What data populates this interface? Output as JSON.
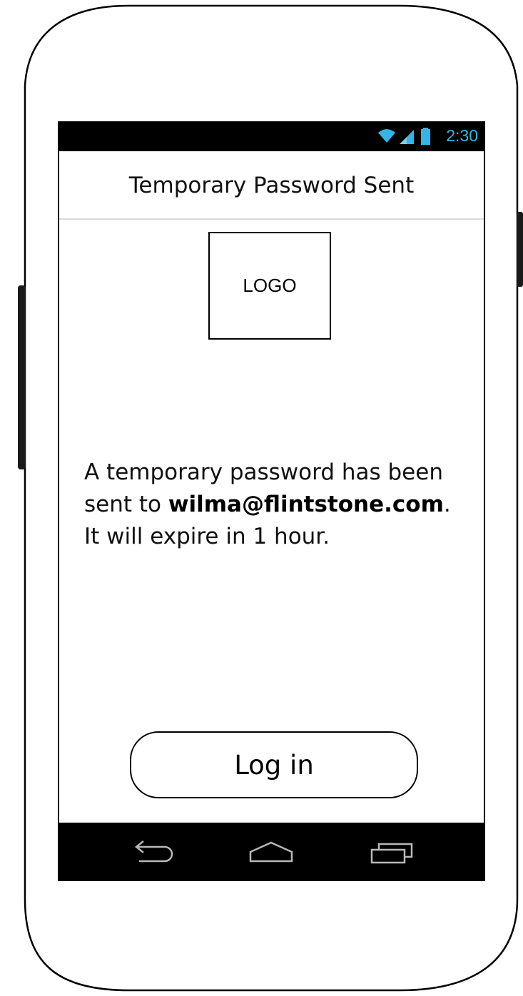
{
  "status_bar": {
    "time": "2:30",
    "accent_color": "#33b5e5",
    "icons": [
      "wifi-icon",
      "signal-icon",
      "battery-icon"
    ]
  },
  "header": {
    "title": "Temporary Password Sent"
  },
  "logo": {
    "label": "LOGO"
  },
  "message": {
    "part1": "A temporary password has been sent to ",
    "email": "wilma@flintstone.com",
    "part2": ". It will expire in 1 hour."
  },
  "login_button": {
    "label": "Log in"
  },
  "nav_bar": {
    "icons": [
      "back-icon",
      "home-icon",
      "recent-apps-icon"
    ]
  }
}
